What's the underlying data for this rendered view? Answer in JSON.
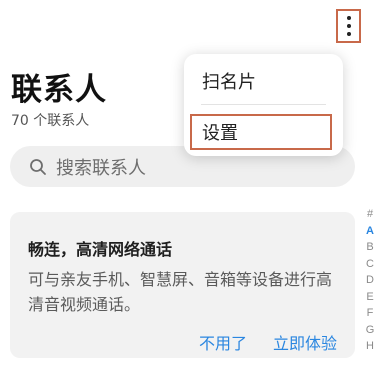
{
  "header": {
    "title": "联系人",
    "contact_count": "70 个联系人",
    "more_icon": "more-vertical-icon"
  },
  "search": {
    "placeholder": "搜索联系人",
    "icon": "search-icon"
  },
  "menu": {
    "items": [
      {
        "label": "扫名片"
      },
      {
        "label": "设置"
      }
    ]
  },
  "promo": {
    "title": "畅连，高清网络通话",
    "body": "可与亲友手机、智慧屏、音箱等设备进行高清音视频通话。",
    "dismiss_label": "不用了",
    "try_label": "立即体验"
  },
  "alpha_index": [
    "#",
    "A",
    "B",
    "C",
    "D",
    "E",
    "F",
    "G",
    "H"
  ],
  "alpha_active": "A",
  "colors": {
    "accent": "#2a86e0",
    "highlight_box": "#c8694a",
    "card_bg": "#f2f2f2",
    "search_bg": "#efefef"
  }
}
